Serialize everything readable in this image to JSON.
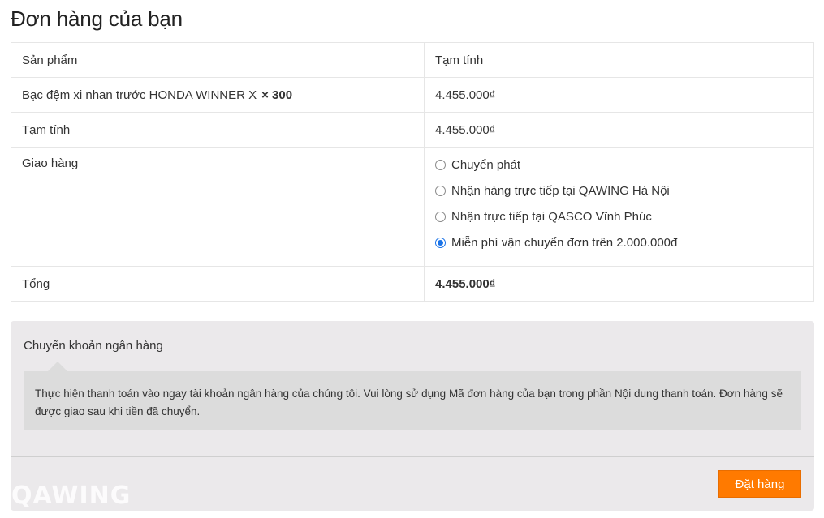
{
  "heading": "Đơn hàng của bạn",
  "table": {
    "header": {
      "product": "Sản phẩm",
      "subtotal": "Tạm tính"
    },
    "item": {
      "name": "Bạc đệm xi nhan trước HONDA WINNER X",
      "quantity": "× 300",
      "price": "4.455.000₫"
    },
    "subtotal_row": {
      "label": "Tạm tính",
      "value": "4.455.000₫"
    },
    "shipping": {
      "label": "Giao hàng",
      "options": [
        {
          "label": "Chuyển phát",
          "checked": false
        },
        {
          "label": "Nhận hàng trực tiếp tại QAWING Hà Nội",
          "checked": false
        },
        {
          "label": "Nhận trực tiếp tại QASCO Vĩnh Phúc",
          "checked": false
        },
        {
          "label": "Miễn phí vận chuyển đơn trên 2.000.000đ",
          "checked": true
        }
      ]
    },
    "total_row": {
      "label": "Tổng",
      "value": "4.455.000₫"
    }
  },
  "payment": {
    "method": "Chuyển khoản ngân hàng",
    "description": "Thực hiện thanh toán vào ngay tài khoản ngân hàng của chúng tôi. Vui lòng sử dụng Mã đơn hàng của bạn trong phần Nội dung thanh toán. Đơn hàng sẽ được giao sau khi tiền đã chuyển.",
    "place_order_label": "Đặt hàng"
  },
  "watermark": "QAWING",
  "colors": {
    "accent": "#ff7a00",
    "radio_checked": "#1a73e8",
    "panel_bg": "#ebe9eb"
  }
}
